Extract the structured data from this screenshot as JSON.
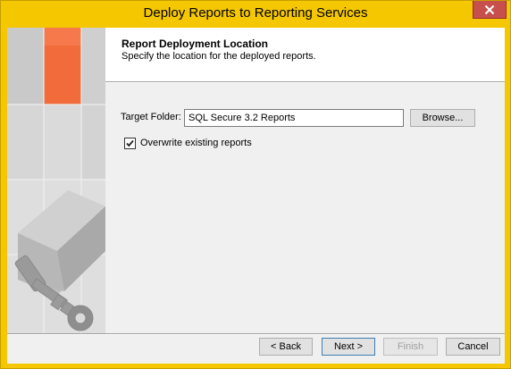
{
  "window": {
    "title": "Deploy Reports to Reporting Services"
  },
  "header": {
    "title": "Report Deployment Location",
    "subtitle": "Specify the location for the deployed reports."
  },
  "form": {
    "target_folder_label": "Target Folder:",
    "target_folder_value": "SQL Secure 3.2 Reports",
    "browse_label": "Browse...",
    "overwrite_label": "Overwrite existing reports",
    "overwrite_checked": true
  },
  "footer": {
    "back_label": "< Back",
    "next_label": "Next >",
    "finish_label": "Finish",
    "cancel_label": "Cancel"
  },
  "colors": {
    "title_bar": "#f5c700",
    "accent_tile": "#f26b3a",
    "close_button": "#c7504c"
  },
  "icons": {
    "close": "close-icon",
    "checkmark": "checkmark-icon",
    "sidebar_art": "key-cube-illustration"
  }
}
